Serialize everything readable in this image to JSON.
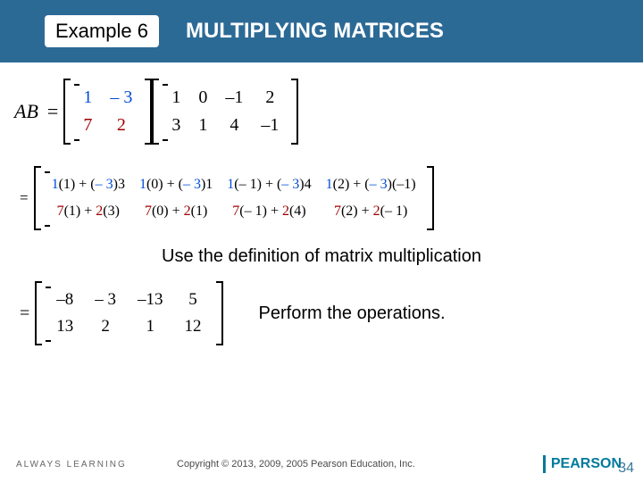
{
  "header": {
    "example_label": "Example 6",
    "title": "MULTIPLYING MATRICES"
  },
  "eq1": {
    "AB": "AB",
    "eq": "=",
    "A": [
      [
        "1",
        "– 3"
      ],
      [
        "7",
        "2"
      ]
    ],
    "B": [
      [
        "1",
        "0",
        "–1",
        "2"
      ],
      [
        "3",
        "1",
        "4",
        "–1"
      ]
    ]
  },
  "eq2": {
    "eq": "=",
    "rows": [
      [
        "1(1) + (– 3)3",
        "1(0) + (– 3)1",
        "1(– 1) + (– 3)4",
        "1(2) + (– 3)(–1)"
      ],
      [
        "7(1) + 2(3)",
        "7(0) + 2(1)",
        "7(– 1) + 2(4)",
        "7(2) + 2(– 1)"
      ]
    ],
    "row1_markup": [
      [
        {
          "t": "1",
          "c": "blue"
        },
        {
          "t": "(1) + (",
          "c": ""
        },
        {
          "t": "– 3",
          "c": "blue"
        },
        {
          "t": ")3",
          "c": ""
        }
      ],
      [
        {
          "t": "1",
          "c": "blue"
        },
        {
          "t": "(0) + (",
          "c": ""
        },
        {
          "t": "– 3",
          "c": "blue"
        },
        {
          "t": ")1",
          "c": ""
        }
      ],
      [
        {
          "t": "1",
          "c": "blue"
        },
        {
          "t": "(– 1) + (",
          "c": ""
        },
        {
          "t": "– 3",
          "c": "blue"
        },
        {
          "t": ")4",
          "c": ""
        }
      ],
      [
        {
          "t": "1",
          "c": "blue"
        },
        {
          "t": "(2) + (",
          "c": ""
        },
        {
          "t": "– 3",
          "c": "blue"
        },
        {
          "t": ")(–1)",
          "c": ""
        }
      ]
    ],
    "row2_markup": [
      [
        {
          "t": "7",
          "c": "red"
        },
        {
          "t": "(1) + ",
          "c": ""
        },
        {
          "t": "2",
          "c": "red"
        },
        {
          "t": "(3)",
          "c": ""
        }
      ],
      [
        {
          "t": "7",
          "c": "red"
        },
        {
          "t": "(0) + ",
          "c": ""
        },
        {
          "t": "2",
          "c": "red"
        },
        {
          "t": "(1)",
          "c": ""
        }
      ],
      [
        {
          "t": "7",
          "c": "red"
        },
        {
          "t": "(– 1) + ",
          "c": ""
        },
        {
          "t": "2",
          "c": "red"
        },
        {
          "t": "(4)",
          "c": ""
        }
      ],
      [
        {
          "t": "7",
          "c": "red"
        },
        {
          "t": "(2) + ",
          "c": ""
        },
        {
          "t": "2",
          "c": "red"
        },
        {
          "t": "(– 1)",
          "c": ""
        }
      ]
    ]
  },
  "caption1": "Use the definition of matrix multiplication",
  "eq3": {
    "eq": "=",
    "result": [
      [
        "–8",
        "– 3",
        "–13",
        "5"
      ],
      [
        "13",
        "2",
        "1",
        "12"
      ]
    ]
  },
  "caption2": "Perform the operations.",
  "footer": {
    "always": "ALWAYS LEARNING",
    "copyright": "Copyright © 2013, 2009, 2005 Pearson Education, Inc.",
    "brand": "PEARSON",
    "page": "34"
  }
}
